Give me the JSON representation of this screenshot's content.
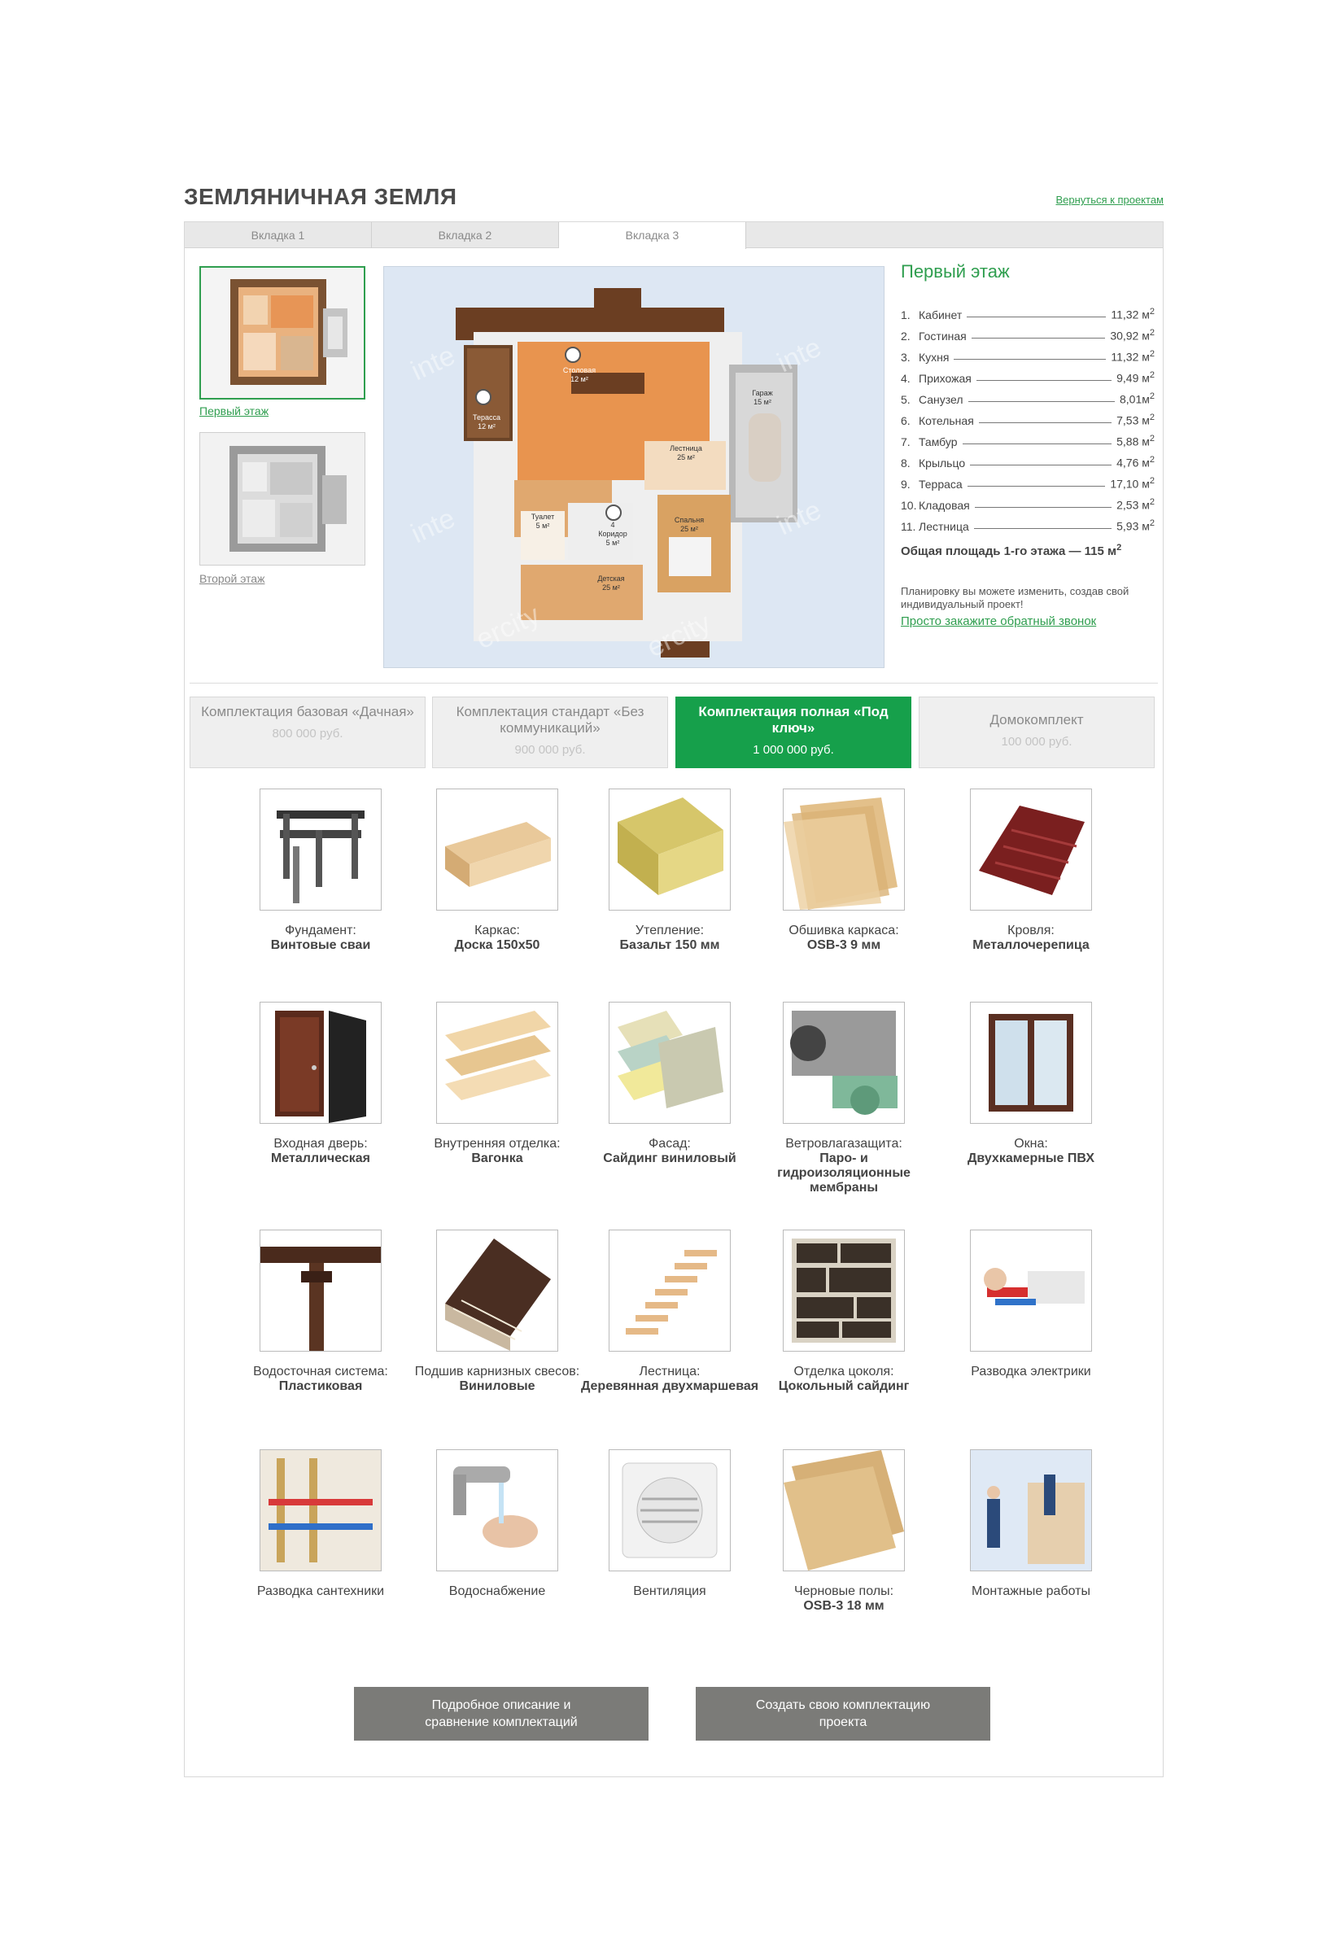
{
  "page": {
    "title": "ЗЕМЛЯНИЧНАЯ ЗЕМЛЯ",
    "back_link": "Вернуться к проектам"
  },
  "tabs": [
    {
      "label": "Вкладка 1"
    },
    {
      "label": "Вкладка 2"
    },
    {
      "label": "Вкладка 3"
    }
  ],
  "floors": [
    {
      "label": "Первый этаж"
    },
    {
      "label": "Второй этаж"
    }
  ],
  "plan": {
    "watermark": "intercity",
    "rooms": [
      {
        "num": "1",
        "name": "Терасса",
        "area": "12 м²"
      },
      {
        "num": "2",
        "name": "Столовая",
        "area": "12 м²"
      },
      {
        "num": "",
        "name": "Гараж",
        "area": "15 м²"
      },
      {
        "num": "",
        "name": "Лестница",
        "area": "25 м²"
      },
      {
        "num": "",
        "name": "Туалет",
        "area": "5 м²"
      },
      {
        "num": "4",
        "name": "Коридор",
        "area": "5 м²"
      },
      {
        "num": "",
        "name": "Спальня",
        "area": "25 м²"
      },
      {
        "num": "",
        "name": "Детская",
        "area": "25 м²"
      }
    ]
  },
  "floor_info": {
    "title": "Первый этаж",
    "rooms": [
      {
        "num": "1.",
        "name": "Кабинет",
        "area": "11,32 м",
        "sup": "2"
      },
      {
        "num": "2.",
        "name": "Гостиная",
        "area": "30,92 м",
        "sup": "2"
      },
      {
        "num": "3.",
        "name": "Кухня",
        "area": "11,32 м",
        "sup": "2"
      },
      {
        "num": "4.",
        "name": "Прихожая",
        "area": "9,49 м",
        "sup": "2"
      },
      {
        "num": "5.",
        "name": "Санузел",
        "area": "8,01м",
        "sup": "2"
      },
      {
        "num": "6.",
        "name": "Котельная",
        "area": "7,53 м",
        "sup": "2"
      },
      {
        "num": "7.",
        "name": "Тамбур",
        "area": "5,88 м",
        "sup": "2"
      },
      {
        "num": "8.",
        "name": "Крыльцо",
        "area": "4,76 м",
        "sup": "2"
      },
      {
        "num": "9.",
        "name": "Терраса",
        "area": "17,10 м",
        "sup": "2"
      },
      {
        "num": "10.",
        "name": "Кладовая",
        "area": "2,53 м",
        "sup": "2"
      },
      {
        "num": "11.",
        "name": "Лестница",
        "area": "5,93 м",
        "sup": "2"
      }
    ],
    "total": "Общая площадь 1-го этажа — 115 м",
    "total_sup": "2",
    "note": "Планировку вы можете изменить, создав свой индивидуальный проект!",
    "callback": "Просто закажите обратный звонок"
  },
  "packages": [
    {
      "name": "Комплектация базовая «Дачная»",
      "price": "800 000 руб.",
      "active": false
    },
    {
      "name": "Комплектация стандарт «Без коммуникаций»",
      "price": "900 000 руб.",
      "active": false
    },
    {
      "name": "Комплектация полная «Под ключ»",
      "price": "1 000 000 руб.",
      "active": true
    },
    {
      "name": "Домокомплект",
      "price": "100 000 руб.",
      "active": false
    }
  ],
  "items": [
    {
      "label": "Фундамент:",
      "value": "Винтовые сваи",
      "icon": "screw-piles-icon"
    },
    {
      "label": "Каркас:",
      "value": "Доска 150х50",
      "icon": "lumber-icon"
    },
    {
      "label": "Утепление:",
      "value": "Базальт 150 мм",
      "icon": "insulation-icon"
    },
    {
      "label": "Обшивка каркаса:",
      "value": "OSB-3 9 мм",
      "icon": "osb-sheets-icon"
    },
    {
      "label": "Кровля:",
      "value": "Металлочерепица",
      "icon": "metal-tile-icon"
    },
    {
      "label": "Входная дверь:",
      "value": "Металлическая",
      "icon": "door-icon"
    },
    {
      "label": "Внутренняя отделка:",
      "value": "Вагонка",
      "icon": "wood-panel-icon"
    },
    {
      "label": "Фасад:",
      "value": "Сайдинг виниловый",
      "icon": "siding-icon"
    },
    {
      "label": "Ветровлагазащита:",
      "value": "Паро- и гидроизоляционные мембраны",
      "icon": "membrane-roll-icon"
    },
    {
      "label": "Окна:",
      "value": "Двухкамерные ПВХ",
      "icon": "window-icon"
    },
    {
      "label": "Водосточная система:",
      "value": "Пластиковая",
      "icon": "gutter-icon"
    },
    {
      "label": "Подшив карнизных свесов:",
      "value": "Виниловые",
      "icon": "soffit-icon"
    },
    {
      "label": "Лестница:",
      "value": "Деревянная двухмаршевая",
      "icon": "stairs-icon"
    },
    {
      "label": "Отделка цоколя:",
      "value": "Цокольный сайдинг",
      "icon": "stone-siding-icon"
    },
    {
      "label": "Разводка электрики",
      "value": "",
      "icon": "electric-wiring-icon"
    },
    {
      "label": "Разводка сантехники",
      "value": "",
      "icon": "plumbing-icon"
    },
    {
      "label": "Водоснабжение",
      "value": "",
      "icon": "water-tap-icon"
    },
    {
      "label": "Вентиляция",
      "value": "",
      "icon": "ventilation-fan-icon"
    },
    {
      "label": "Черновые полы:",
      "value": "OSB-3 18 мм",
      "icon": "osb-floor-icon"
    },
    {
      "label": "Монтажные работы",
      "value": "",
      "icon": "construction-workers-icon"
    }
  ],
  "buttons": {
    "details": "Подробное описание и сравнение комплектаций",
    "custom": "Создать свою комплектацию проекта"
  },
  "colors": {
    "accent": "#16a04b",
    "link": "#2f9e4f",
    "button_gray": "#7b7b78"
  }
}
